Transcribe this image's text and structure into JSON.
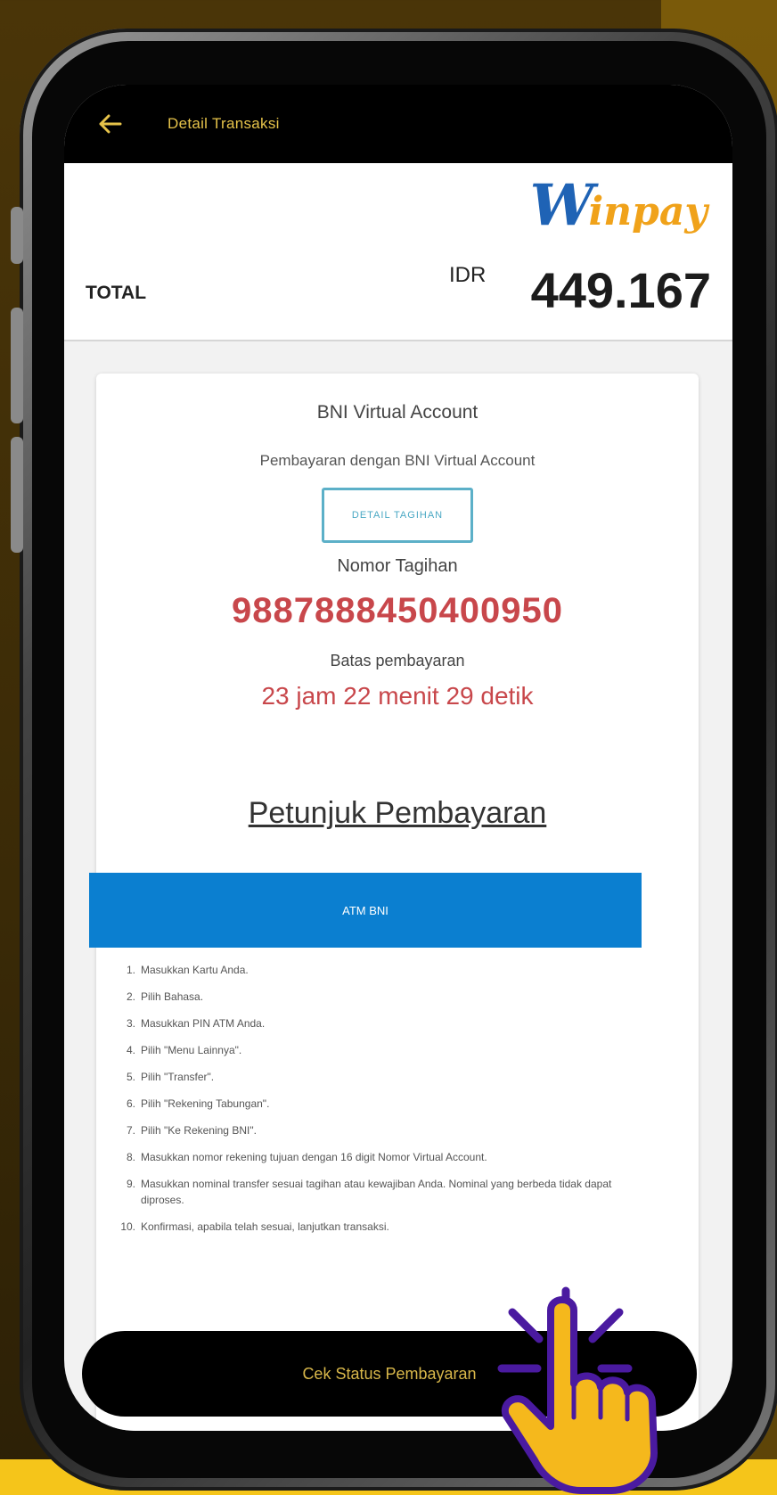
{
  "app_bar": {
    "title": "Detail Transaksi",
    "back_icon": "arrow-left-icon",
    "title_color": "#e6c34a"
  },
  "logo": {
    "name": "Winpay",
    "w": "W",
    "rest": "inpay"
  },
  "total": {
    "label": "TOTAL",
    "currency": "IDR",
    "amount": "449.167"
  },
  "payment_card": {
    "title": "BNI Virtual Account",
    "subtitle": "Pembayaran dengan BNI Virtual Account",
    "detail_button_label": "DETAIL TAGIHAN",
    "bill_number_label": "Nomor Tagihan",
    "bill_number": "9887888450400950",
    "deadline_label": "Batas pembayaran",
    "countdown": "23 jam 22 menit 29 detik",
    "highlight_color": "#c8474b"
  },
  "instructions": {
    "title": "Petunjuk Pembayaran",
    "tab_label": "ATM BNI",
    "tab_color": "#0b7fd0",
    "steps": [
      {
        "num": "1.",
        "text": "Masukkan Kartu Anda."
      },
      {
        "num": "2.",
        "text": "Pilih Bahasa."
      },
      {
        "num": "3.",
        "text": "Masukkan PIN ATM Anda."
      },
      {
        "num": "4.",
        "text": "Pilih \"Menu Lainnya\"."
      },
      {
        "num": "5.",
        "text": "Pilih \"Transfer\"."
      },
      {
        "num": "6.",
        "text": "Pilih \"Rekening Tabungan\"."
      },
      {
        "num": "7.",
        "text": "Pilih \"Ke Rekening BNI\"."
      },
      {
        "num": "8.",
        "text": "Masukkan nomor rekening tujuan dengan 16 digit Nomor Virtual Account."
      },
      {
        "num": "9.",
        "text": "Masukkan nominal transfer sesuai tagihan atau kewajiban Anda. Nominal yang berbeda tidak dapat diproses."
      },
      {
        "num": "10.",
        "text": "Konfirmasi, apabila telah sesuai, lanjutkan transaksi."
      }
    ]
  },
  "footer": {
    "status_button_label": "Cek Status Pembayaran",
    "status_button_color": "#d8b74a"
  },
  "overlay": {
    "hand_icon": "pointing-hand-icon",
    "sparkle_icon": "click-sparkle-icon",
    "hand_color": "#f5b81c",
    "outline_color": "#4a1aa0"
  }
}
